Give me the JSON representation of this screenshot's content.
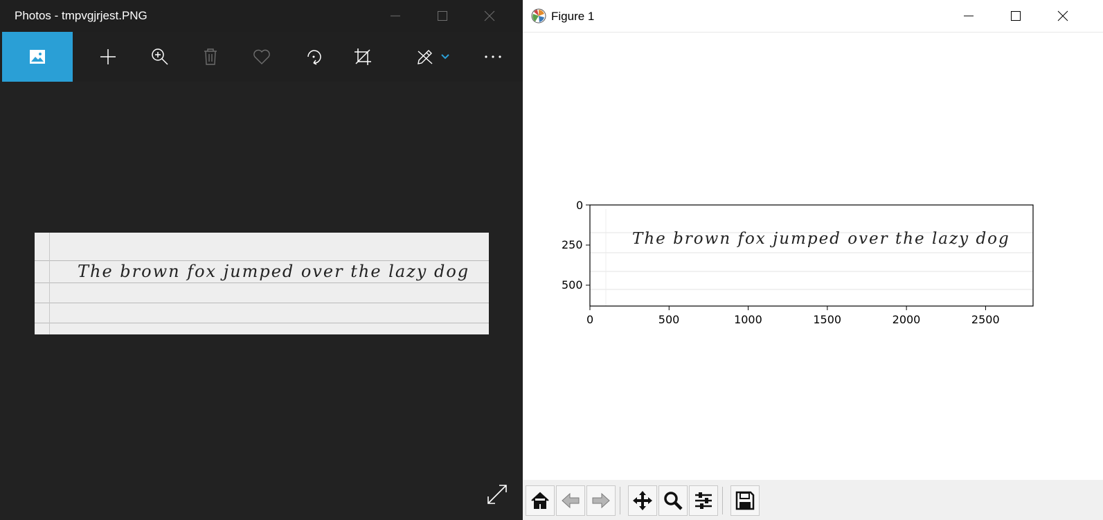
{
  "photos": {
    "title": "Photos - tmpvgjrjest.PNG",
    "toolbar": {
      "view_icon": "image-icon",
      "add_icon": "plus-icon",
      "zoom_icon": "zoom-in-icon",
      "delete_icon": "trash-icon",
      "favorite_icon": "heart-icon",
      "rotate_icon": "rotate-icon",
      "crop_icon": "crop-icon",
      "edit_icon": "edit-draw-icon",
      "more_icon": "more-icon"
    },
    "image_text": "The brown fox jumped over the lazy dog",
    "accent": "#2a9fd6"
  },
  "figure": {
    "title": "Figure 1",
    "toolbar": {
      "home": "home-icon",
      "back": "back-arrow-icon",
      "forward": "forward-arrow-icon",
      "pan": "pan-icon",
      "zoom": "zoom-icon",
      "configure": "configure-subplots-icon",
      "save": "save-icon"
    }
  },
  "chart_data": {
    "type": "image",
    "image_text": "The brown fox jumped over the lazy dog",
    "x_ticks": [
      "0",
      "500",
      "1000",
      "1500",
      "2000",
      "2500"
    ],
    "y_ticks": [
      "0",
      "250",
      "500"
    ],
    "xlim": [
      0,
      2800
    ],
    "ylim": [
      630,
      0
    ],
    "title": "",
    "xlabel": "",
    "ylabel": ""
  }
}
